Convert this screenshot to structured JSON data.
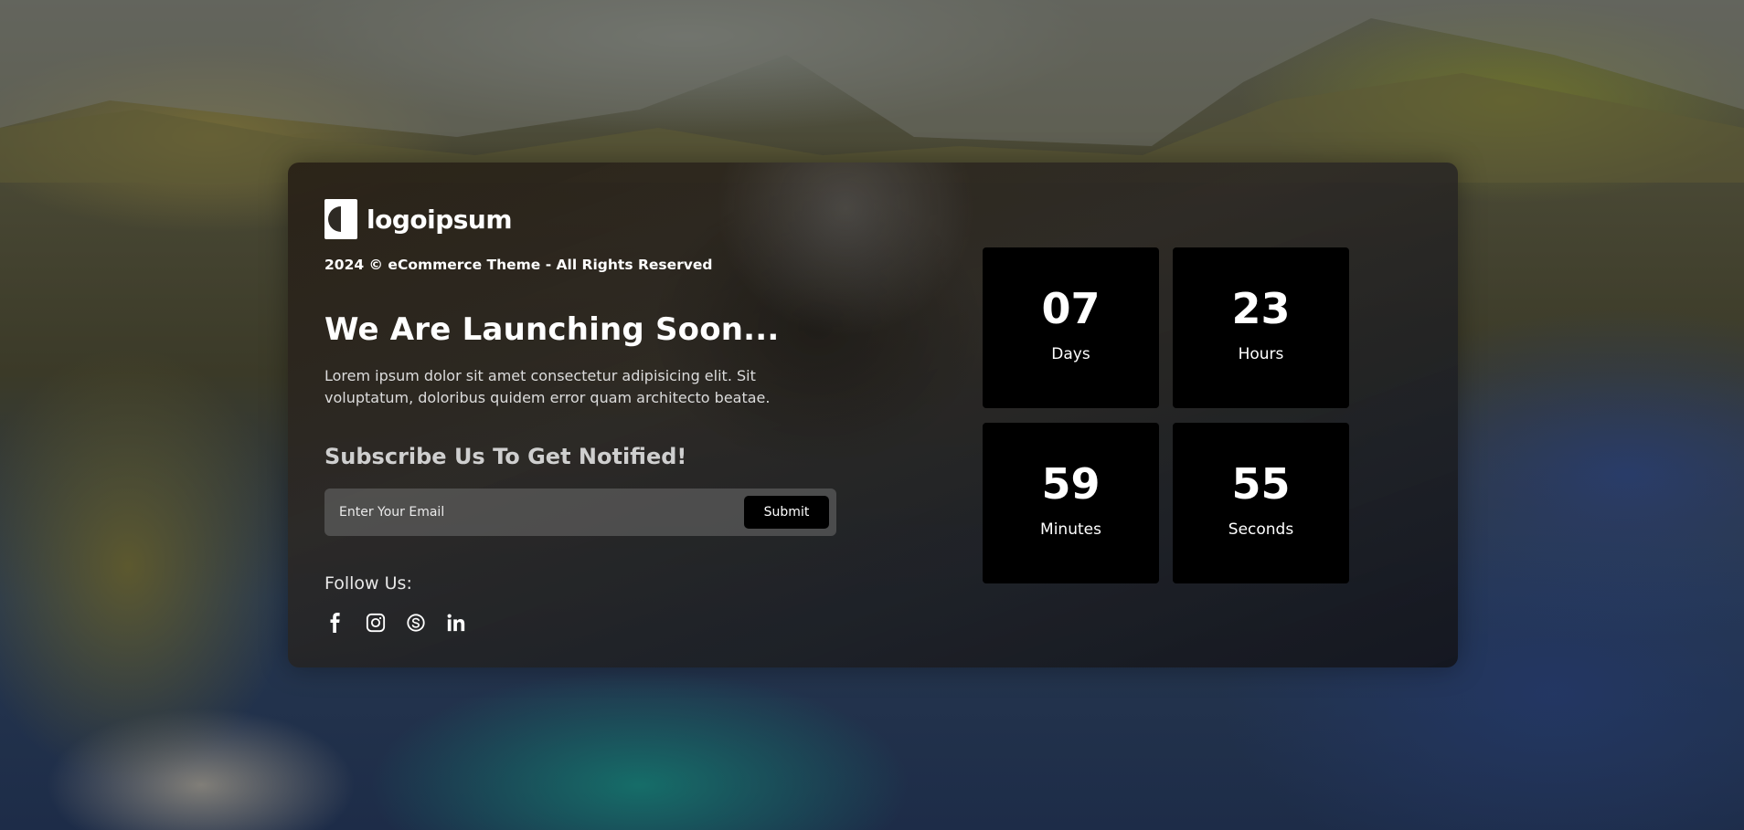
{
  "brand": {
    "logo_text": "logoipsum"
  },
  "footer": {
    "copyright": "2024 © eCommerce Theme - All Rights Reserved"
  },
  "hero": {
    "title": "We Are Launching Soon...",
    "description": "Lorem ipsum dolor sit amet consectetur adipisicing elit. Sit voluptatum, doloribus quidem error quam architecto beatae."
  },
  "subscribe": {
    "title": "Subscribe Us To Get Notified!",
    "email_placeholder": "Enter Your Email",
    "email_value": "",
    "submit_label": "Submit"
  },
  "social": {
    "label": "Follow Us:",
    "items": [
      {
        "icon": "facebook-icon"
      },
      {
        "icon": "instagram-icon"
      },
      {
        "icon": "skype-icon"
      },
      {
        "icon": "linkedin-icon"
      }
    ]
  },
  "countdown": [
    {
      "value": "07",
      "unit": "Days"
    },
    {
      "value": "23",
      "unit": "Hours"
    },
    {
      "value": "59",
      "unit": "Minutes"
    },
    {
      "value": "55",
      "unit": "Seconds"
    }
  ],
  "colors": {
    "accent": "#000000",
    "text": "#ffffff"
  }
}
